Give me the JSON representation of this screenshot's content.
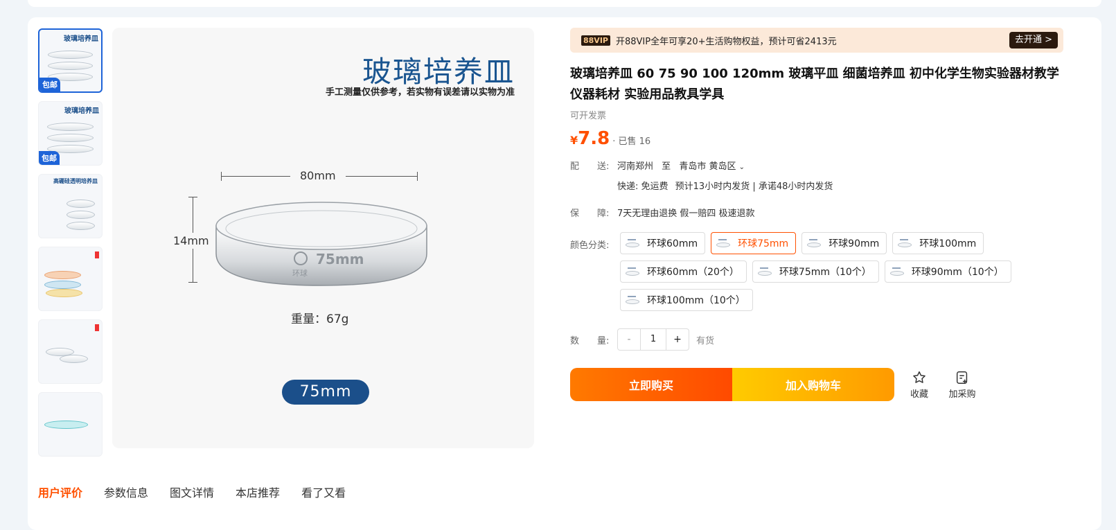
{
  "gallery": {
    "thumbnails": [
      {
        "title": "玻璃培养皿",
        "badge": "包邮"
      },
      {
        "title": "玻璃培养皿",
        "badge": "包邮"
      },
      {
        "title": "高硼硅透明培养皿",
        "badge": ""
      },
      {
        "title": "",
        "badge": ""
      },
      {
        "title": "",
        "badge": ""
      },
      {
        "title": "",
        "badge": ""
      }
    ],
    "main": {
      "title": "玻璃培养皿",
      "subtitle": "手工测量仅供参考，若实物有误差请以实物为准",
      "width_label": "80mm",
      "height_label": "14mm",
      "dish_mark": "75mm",
      "dish_brand": "环球",
      "weight": "重量：67g",
      "size_pill": "75mm"
    }
  },
  "vip": {
    "badge": "88VIP",
    "text": "开88VIP全年可享20+生活购物权益，预计可省2413元",
    "button": "去开通 >"
  },
  "product": {
    "title": "玻璃培养皿 60 75 90 100 120mm 玻璃平皿 细菌培养皿 初中化学生物实验器材教学仪器耗材 实验用品教具学具",
    "invoice": "可开发票",
    "price_symbol": "¥",
    "price": "7.8",
    "sold": "· 已售 16"
  },
  "delivery": {
    "label": "配　　送:",
    "from": "河南郑州",
    "to_word": "至",
    "to": "青岛市 黄岛区",
    "shipping": "快递: 免运费",
    "eta": "预计13小时内发货 | 承诺48小时内发货"
  },
  "guarantee": {
    "label": "保　　障:",
    "text": "7天无理由退换 假一赔四 极速退款"
  },
  "options": {
    "label": "颜色分类:",
    "items": [
      "环球60mm",
      "环球75mm",
      "环球90mm",
      "环球100mm",
      "环球60mm（20个）",
      "环球75mm（10个）",
      "环球90mm（10个）",
      "环球100mm（10个）"
    ],
    "selected_index": 1
  },
  "quantity": {
    "label": "数　　量:",
    "minus": "-",
    "value": "1",
    "plus": "+",
    "stock": "有货"
  },
  "actions": {
    "buy": "立即购买",
    "cart": "加入购物车",
    "favorite": "收藏",
    "purchase": "加采购"
  },
  "tabs": [
    "用户评价",
    "参数信息",
    "图文详情",
    "本店推荐",
    "看了又看"
  ],
  "colors": {
    "accent": "#ff5000",
    "brand_blue": "#1b4f8a",
    "vip_bg": "#fce9d9"
  }
}
